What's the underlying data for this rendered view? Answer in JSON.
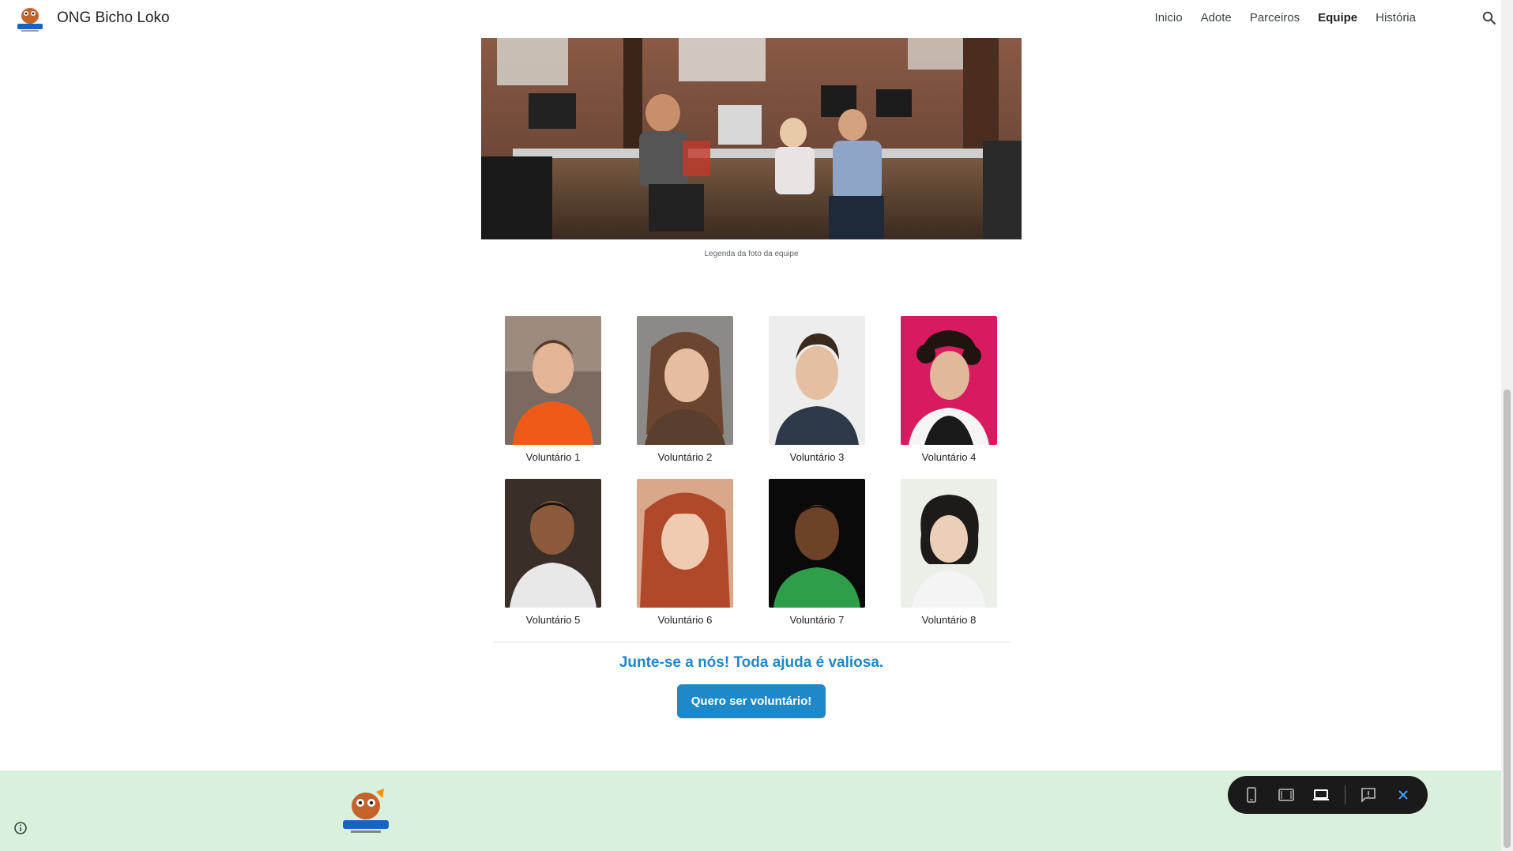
{
  "header": {
    "site_title": "ONG Bicho Loko",
    "nav": [
      "Inicio",
      "Adote",
      "Parceiros",
      "Equipe",
      "História"
    ],
    "active_nav": "Equipe",
    "logo_text": "Bicho Loko"
  },
  "team": {
    "caption": "Legenda da foto da equipe"
  },
  "volunteers": [
    {
      "name": "Voluntário 1"
    },
    {
      "name": "Voluntário 2"
    },
    {
      "name": "Voluntário 3"
    },
    {
      "name": "Voluntário 4"
    },
    {
      "name": "Voluntário 5"
    },
    {
      "name": "Voluntário 6"
    },
    {
      "name": "Voluntário 7"
    },
    {
      "name": "Voluntário 8"
    }
  ],
  "cta": {
    "heading": "Junte-se a nós! Toda ajuda é valiosa.",
    "button": "Quero ser voluntário!"
  },
  "colors": {
    "accent": "#1e88c8",
    "footer_bg": "#d9f0dd",
    "toolbar_bg": "#1a1a1a"
  },
  "icons": {
    "search": "search-icon",
    "info": "info-icon",
    "phone": "phone-preview-icon",
    "tablet": "tablet-preview-icon",
    "laptop": "laptop-preview-icon",
    "feedback": "feedback-icon",
    "close": "close-icon"
  }
}
